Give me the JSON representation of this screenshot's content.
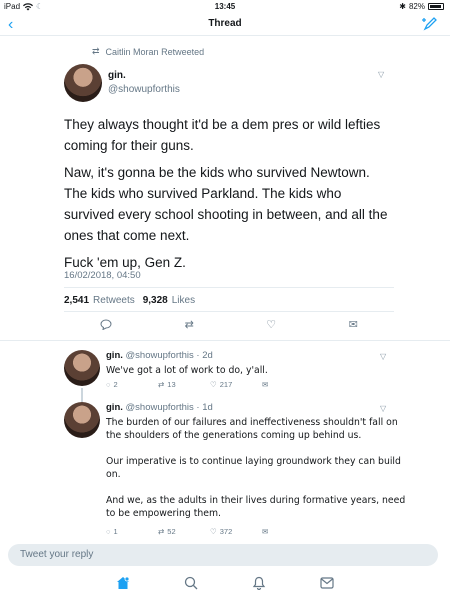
{
  "status_bar": {
    "device": "iPad",
    "time": "13:45",
    "battery": "82%"
  },
  "nav": {
    "title": "Thread"
  },
  "main_tweet": {
    "retweeted_by": "Caitlin Moran Retweeted",
    "name": "gin.",
    "handle": "@showupforthis",
    "paragraphs": [
      "They always thought it'd be a dem pres or wild lefties coming for their guns.",
      "Naw, it's gonna be the kids who survived Newtown. The kids who survived Parkland. The kids who survived every school shooting in between, and all the ones that come next.",
      "Fuck 'em up, Gen Z."
    ],
    "timestamp": "16/02/2018, 04:50",
    "retweets_count": "2,541",
    "retweets_label": "Retweets",
    "likes_count": "9,328",
    "likes_label": "Likes"
  },
  "replies": [
    {
      "name": "gin.",
      "handle": "@showupforthis",
      "age": "2d",
      "paragraphs": [
        "We've got a lot of work to do, y'all."
      ],
      "replies_count": "2",
      "retweets_count": "13",
      "likes_count": "217"
    },
    {
      "name": "gin.",
      "handle": "@showupforthis",
      "age": "1d",
      "paragraphs": [
        "The burden of our failures and ineffectiveness shouldn't fall on the shoulders of the generations coming up behind us.",
        "Our imperative is to continue laying groundwork they can build on.",
        "And we, as the adults in their lives during formative years, need to be empowering them."
      ],
      "replies_count": "1",
      "retweets_count": "52",
      "likes_count": "372"
    }
  ],
  "reply_box": {
    "placeholder": "Tweet your reply"
  },
  "icons": [
    "wifi-icon",
    "battery-icon",
    "bluetooth-icon",
    "back-chevron-icon",
    "compose-tweet-icon",
    "retweet-icon",
    "reply-icon",
    "like-icon",
    "direct-message-icon",
    "home-icon",
    "search-icon",
    "notifications-icon",
    "messages-icon"
  ],
  "colors": {
    "accent": "#1da1f2",
    "secondary_text": "#657786",
    "border": "#e6ecf0"
  }
}
